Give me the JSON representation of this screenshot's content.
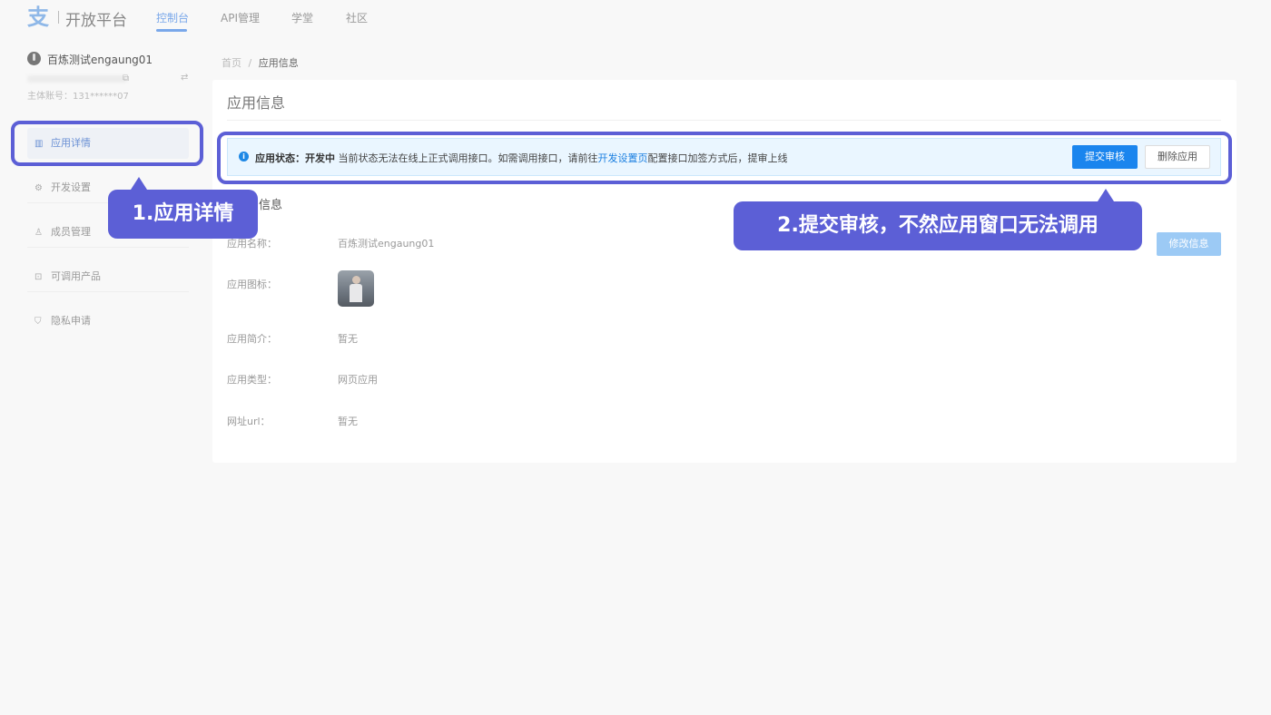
{
  "header": {
    "logo_glyph": "支",
    "logo_text": "开放平台",
    "nav": [
      "控制台",
      "API管理",
      "学堂",
      "社区"
    ],
    "active_nav": "控制台"
  },
  "account": {
    "name": "百炼测试engaung01",
    "id_label": "主体账号：131******07"
  },
  "sidebar": {
    "items": [
      {
        "label": "应用详情",
        "icon": "chart-icon"
      },
      {
        "label": "开发设置",
        "icon": "settings-doc-icon"
      },
      {
        "label": "成员管理",
        "icon": "members-icon"
      },
      {
        "label": "可调用产品",
        "icon": "product-icon"
      },
      {
        "label": "隐私申请",
        "icon": "shield-icon"
      }
    ]
  },
  "breadcrumb": {
    "home": "首页",
    "separator": "/",
    "current": "应用信息"
  },
  "page": {
    "title": "应用信息"
  },
  "alert": {
    "status_label": "应用状态：开发中",
    "text_before_link": " 当前状态无法在线上正式调用接口。如需调用接口，请前往",
    "link_text": "开发设置页",
    "text_after_link": "配置接口加签方式后，提审上线",
    "submit_label": "提交审核",
    "delete_label": "删除应用"
  },
  "section": {
    "title": "信息",
    "edit_label": "修改信息",
    "rows": [
      {
        "label": "应用名称：",
        "value": "百炼测试engaung01"
      },
      {
        "label": "应用图标：",
        "value": ""
      },
      {
        "label": "应用简介：",
        "value": "暂无"
      },
      {
        "label": "应用类型：",
        "value": "网页应用"
      },
      {
        "label": "网址url：",
        "value": "暂无"
      }
    ]
  },
  "annotations": {
    "step1": "1.应用详情",
    "step2": "2.提交审核，不然应用窗口无法调用"
  },
  "colors": {
    "annotation": "#5c5fd6",
    "primary": "#1a85ee",
    "alert_bg": "#eaf6ff"
  }
}
